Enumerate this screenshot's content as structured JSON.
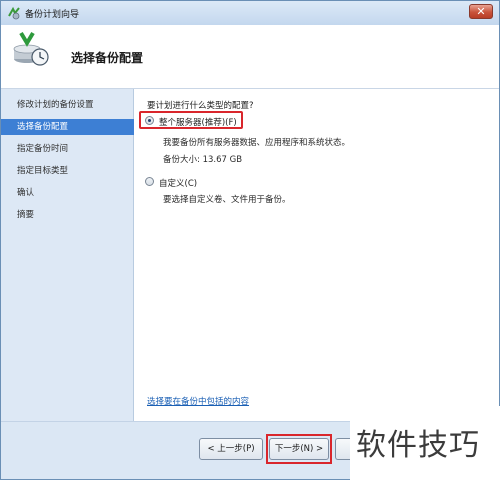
{
  "window": {
    "title": "备份计划向导",
    "close_label": "✕"
  },
  "header": {
    "title": "选择备份配置",
    "icon": "backup-schedule-icon"
  },
  "sidebar": {
    "items": [
      {
        "label": "修改计划的备份设置",
        "active": false
      },
      {
        "label": "选择备份配置",
        "active": true
      },
      {
        "label": "指定备份时间",
        "active": false
      },
      {
        "label": "指定目标类型",
        "active": false
      },
      {
        "label": "确认",
        "active": false
      },
      {
        "label": "摘要",
        "active": false
      }
    ]
  },
  "content": {
    "question": "要计划进行什么类型的配置?",
    "option_full": {
      "label": "整个服务器(推荐)(F)",
      "checked": true,
      "description": "我要备份所有服务器数据、应用程序和系统状态。",
      "size": "备份大小: 13.67 GB"
    },
    "option_custom": {
      "label": "自定义(C)",
      "checked": false,
      "description": "要选择自定义卷、文件用于备份。"
    },
    "link": "选择要在备份中包括的内容"
  },
  "footer": {
    "back_label": "< 上一步(P)",
    "next_label": "下一步(N) >"
  },
  "watermark": "软件技巧",
  "colors": {
    "highlight": "#d9262c",
    "sidebar_active": "#3d7fd4",
    "sidebar_bg": "#dde8f5",
    "link": "#1a5fb4"
  }
}
